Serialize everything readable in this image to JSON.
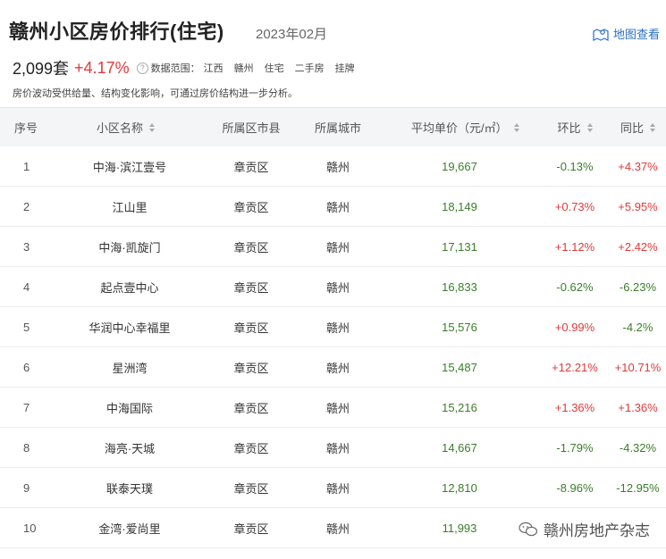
{
  "header": {
    "title": "赣州小区房价排行(住宅)",
    "period": "2023年02月",
    "map_link": "地图查看"
  },
  "summary": {
    "count": "2,099套",
    "change": "+4.17%",
    "scope_label": "数据范围：",
    "scope": [
      "江西",
      "赣州",
      "住宅",
      "二手房",
      "挂牌"
    ],
    "note": "房价波动受供给量、结构变化影响，可通过房价结构进一步分析。"
  },
  "columns": [
    "序号",
    "小区名称",
    "所属区市县",
    "所属城市",
    "平均单价（元/㎡）",
    "环比",
    "同比"
  ],
  "rows": [
    {
      "rank": "1",
      "name": "中海·滨江壹号",
      "district": "章贡区",
      "city": "赣州",
      "price": "19,667",
      "mom": "-0.13%",
      "yoy": "+4.37%"
    },
    {
      "rank": "2",
      "name": "江山里",
      "district": "章贡区",
      "city": "赣州",
      "price": "18,149",
      "mom": "+0.73%",
      "yoy": "+5.95%"
    },
    {
      "rank": "3",
      "name": "中海·凯旋门",
      "district": "章贡区",
      "city": "赣州",
      "price": "17,131",
      "mom": "+1.12%",
      "yoy": "+2.42%"
    },
    {
      "rank": "4",
      "name": "起点壹中心",
      "district": "章贡区",
      "city": "赣州",
      "price": "16,833",
      "mom": "-0.62%",
      "yoy": "-6.23%"
    },
    {
      "rank": "5",
      "name": "华润中心幸福里",
      "district": "章贡区",
      "city": "赣州",
      "price": "15,576",
      "mom": "+0.99%",
      "yoy": "-4.2%"
    },
    {
      "rank": "6",
      "name": "星洲湾",
      "district": "章贡区",
      "city": "赣州",
      "price": "15,487",
      "mom": "+12.21%",
      "yoy": "+10.71%"
    },
    {
      "rank": "7",
      "name": "中海国际",
      "district": "章贡区",
      "city": "赣州",
      "price": "15,216",
      "mom": "+1.36%",
      "yoy": "+1.36%"
    },
    {
      "rank": "8",
      "name": "海亮·天城",
      "district": "章贡区",
      "city": "赣州",
      "price": "14,667",
      "mom": "-1.79%",
      "yoy": "-4.32%"
    },
    {
      "rank": "9",
      "name": "联泰天璞",
      "district": "章贡区",
      "city": "赣州",
      "price": "12,810",
      "mom": "-8.96%",
      "yoy": "-12.95%"
    },
    {
      "rank": "10",
      "name": "金湾·爱尚里",
      "district": "章贡区",
      "city": "赣州",
      "price": "11,993",
      "mom": "",
      "yoy": ""
    }
  ],
  "watermark": "赣州房地产杂志",
  "colors": {
    "up": "#e03a3a",
    "down": "#3a7d2a",
    "link": "#2a6fc9",
    "header_bg": "#f4f5f7"
  },
  "icons": {
    "map": "map-pin-icon",
    "help": "question-mark-icon",
    "sort": "sort-arrows-icon",
    "watermark": "wechat-icon"
  }
}
